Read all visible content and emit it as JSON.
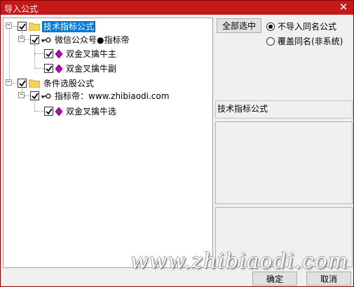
{
  "window": {
    "title": "导入公式",
    "close_glyph": "✕"
  },
  "tree": {
    "nodes": [
      {
        "label": "技术指标公式",
        "icon": "folder-icon",
        "checked": true,
        "expanded": true,
        "selected": true
      },
      {
        "label": "微信公众号●指标帝",
        "icon": "key-icon",
        "checked": true,
        "expanded": true
      },
      {
        "label": "双金叉擒牛主",
        "icon": "gem-icon",
        "checked": true
      },
      {
        "label": "双金叉擒牛副",
        "icon": "gem-icon",
        "checked": true
      },
      {
        "label": "条件选股公式",
        "icon": "folder-icon",
        "checked": true,
        "expanded": true
      },
      {
        "label": "指标帝：www.zhibiaodi.com",
        "icon": "key-icon",
        "checked": true,
        "expanded": true
      },
      {
        "label": "双金叉擒牛选",
        "icon": "gem-icon",
        "checked": true
      }
    ]
  },
  "right": {
    "select_all_label": "全部选中",
    "radio_options": [
      {
        "label": "不导入同名公式",
        "selected": true
      },
      {
        "label": "覆盖同名(非系统)",
        "selected": false
      }
    ],
    "description_title": "技术指标公式"
  },
  "footer": {
    "ok_label": "确定",
    "cancel_label": "取消"
  },
  "watermark": "www.zhibiaodi.com",
  "colors": {
    "title_bar": "#c41a1a",
    "selection": "#0078d7",
    "gem": "#c000c0"
  }
}
